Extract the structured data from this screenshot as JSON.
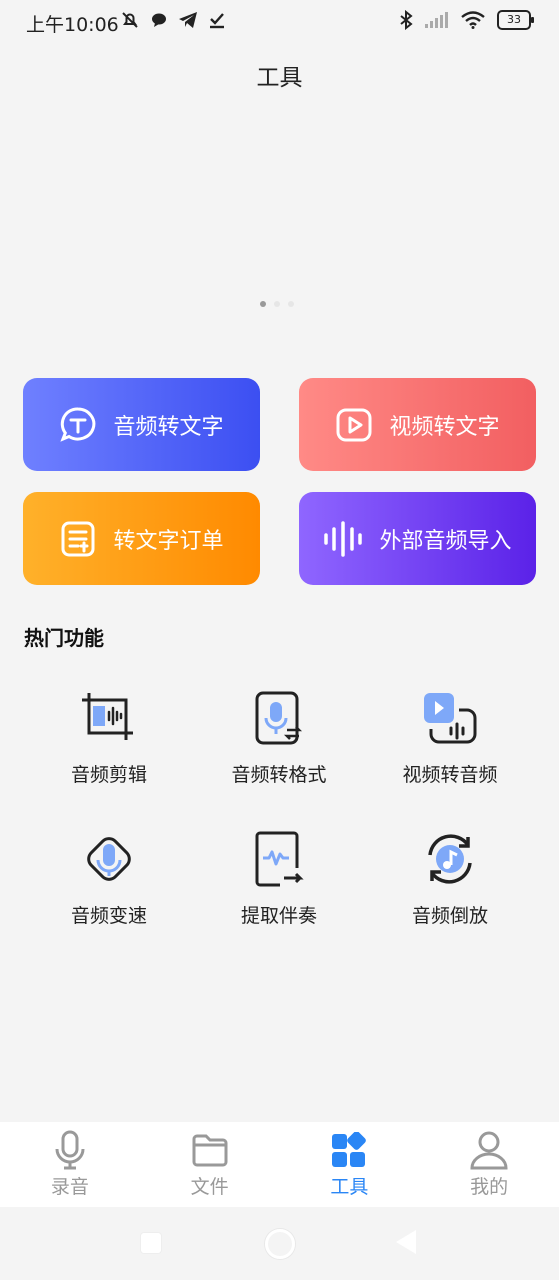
{
  "status": {
    "time": "上午10:06",
    "battery": "33"
  },
  "header": {
    "title": "工具"
  },
  "actions": [
    {
      "label": "音频转文字",
      "icon": "chat-text-icon",
      "color_from": "#6f80ff",
      "color_to": "#3c4ff2"
    },
    {
      "label": "视频转文字",
      "icon": "play-icon",
      "color_from": "#ff8a86",
      "color_to": "#f25f61"
    },
    {
      "label": "转文字订单",
      "icon": "document-icon",
      "color_from": "#ffb12a",
      "color_to": "#ff8a00"
    },
    {
      "label": "外部音频导入",
      "icon": "waveform-icon",
      "color_from": "#8f66ff",
      "color_to": "#5b22e8"
    }
  ],
  "hot": {
    "title": "热门功能",
    "items": [
      {
        "label": "音频剪辑",
        "icon": "crop-audio-icon"
      },
      {
        "label": "音频转格式",
        "icon": "format-convert-icon"
      },
      {
        "label": "视频转音频",
        "icon": "video-to-audio-icon"
      },
      {
        "label": "音频变速",
        "icon": "speed-icon"
      },
      {
        "label": "提取伴奏",
        "icon": "extract-icon"
      },
      {
        "label": "音频倒放",
        "icon": "reverse-icon"
      }
    ]
  },
  "tabs": [
    {
      "label": "录音",
      "icon": "microphone-icon",
      "active": false
    },
    {
      "label": "文件",
      "icon": "folder-icon",
      "active": false
    },
    {
      "label": "工具",
      "icon": "tools-grid-icon",
      "active": true
    },
    {
      "label": "我的",
      "icon": "person-icon",
      "active": false
    }
  ],
  "colors": {
    "accent": "#2a86f5",
    "icon_blue": "#7ea8f8"
  }
}
